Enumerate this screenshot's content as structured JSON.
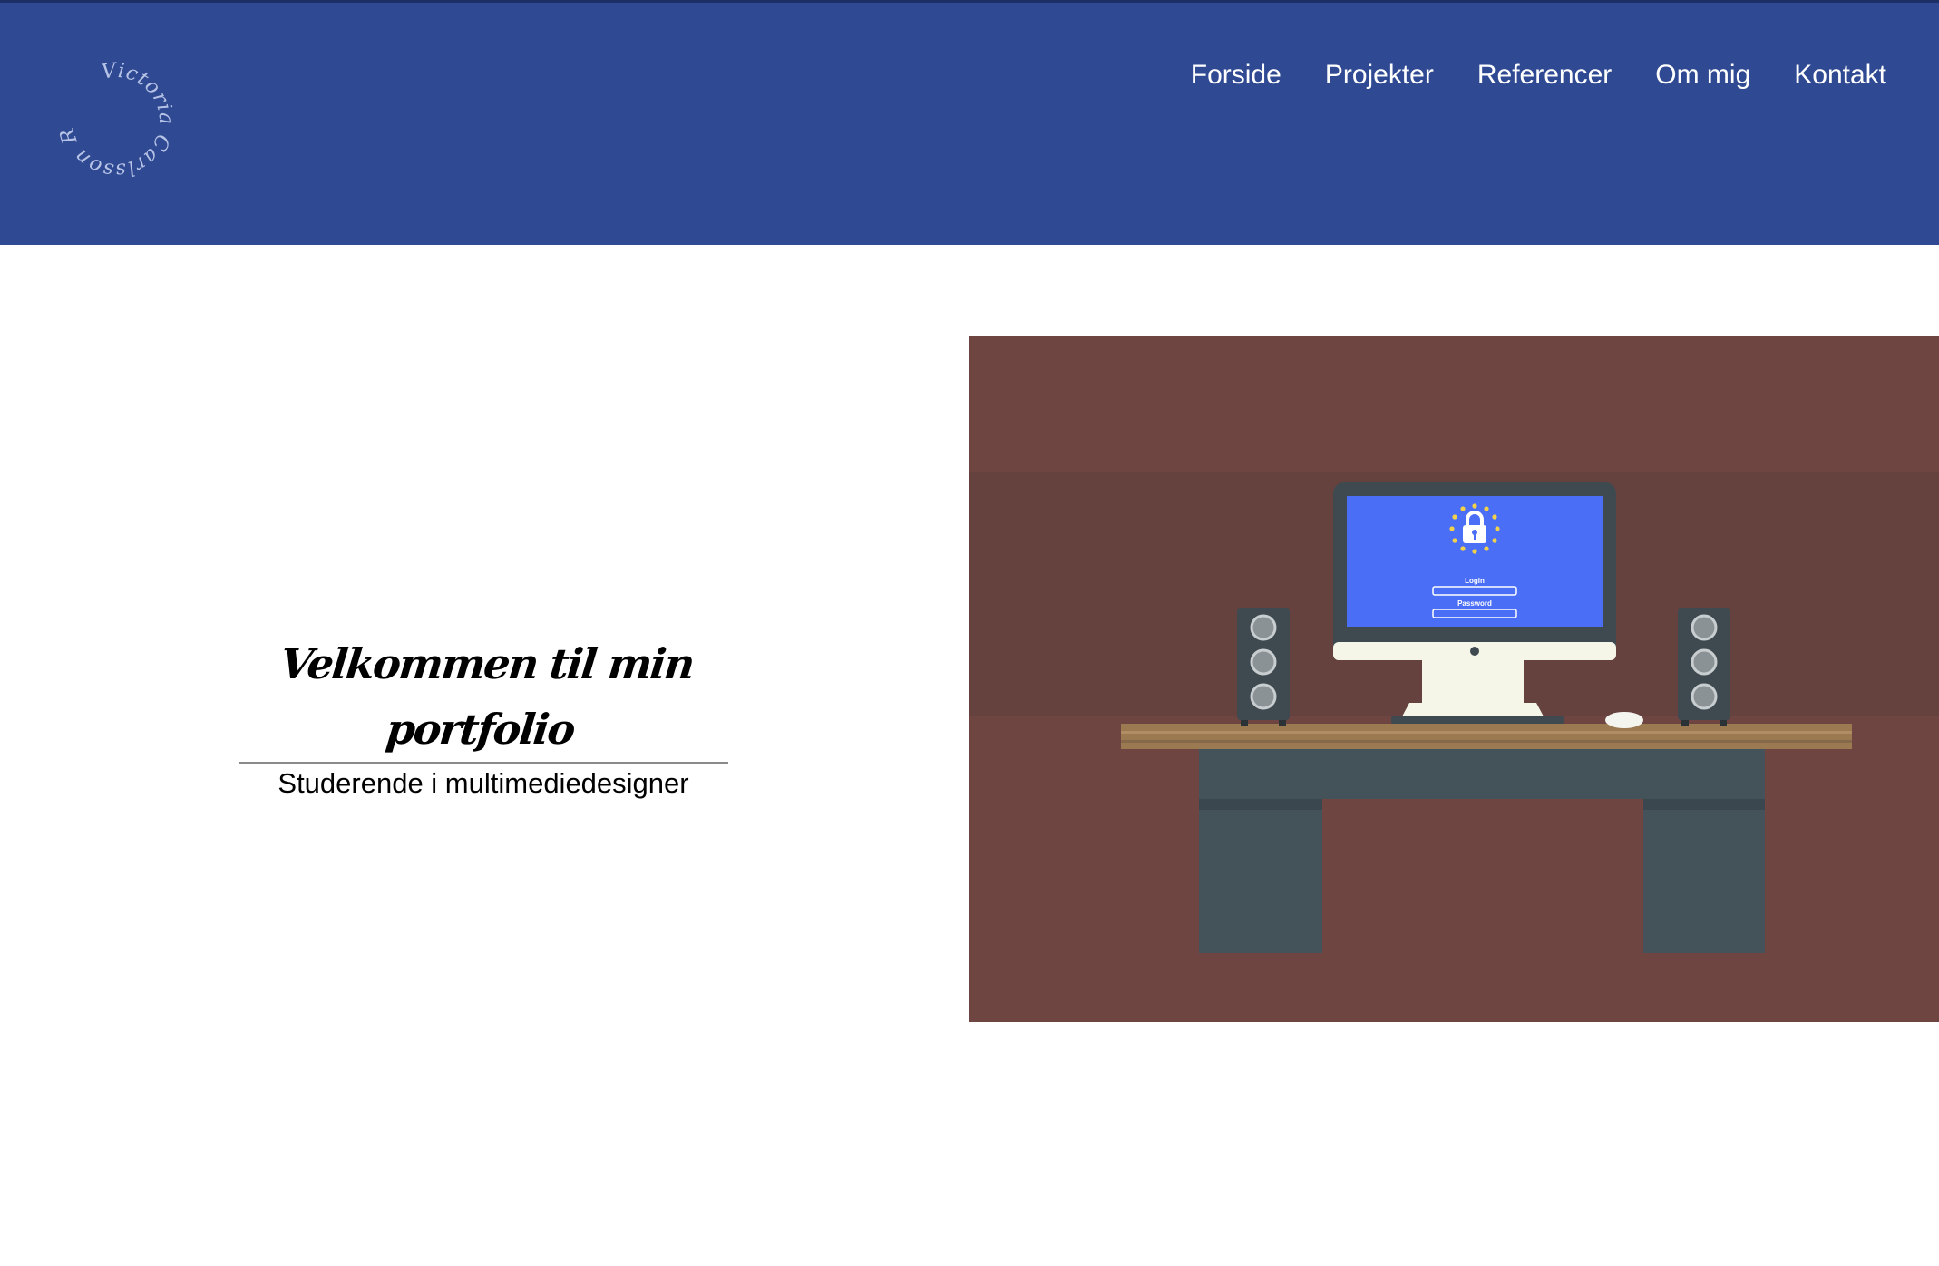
{
  "logo": {
    "text": "Victoria Carlsson Rønne",
    "color": "#b7c3e6"
  },
  "nav": {
    "items": [
      {
        "label": "Forside"
      },
      {
        "label": "Projekter"
      },
      {
        "label": "Referencer"
      },
      {
        "label": "Om mig"
      },
      {
        "label": "Kontakt"
      }
    ]
  },
  "hero": {
    "title": "Velkommen til min portfolio",
    "subtitle": "Studerende i multimediedesigner"
  },
  "illustration": {
    "screen_login_label": "Login",
    "screen_password_label": "Password",
    "icon": "padlock-icon"
  },
  "colors": {
    "header": "#2f4a93",
    "illustration_bg": "#6e4540",
    "screen": "#4a6ef5",
    "desk_top": "#9b7a52",
    "desk_body": "#44525a"
  }
}
